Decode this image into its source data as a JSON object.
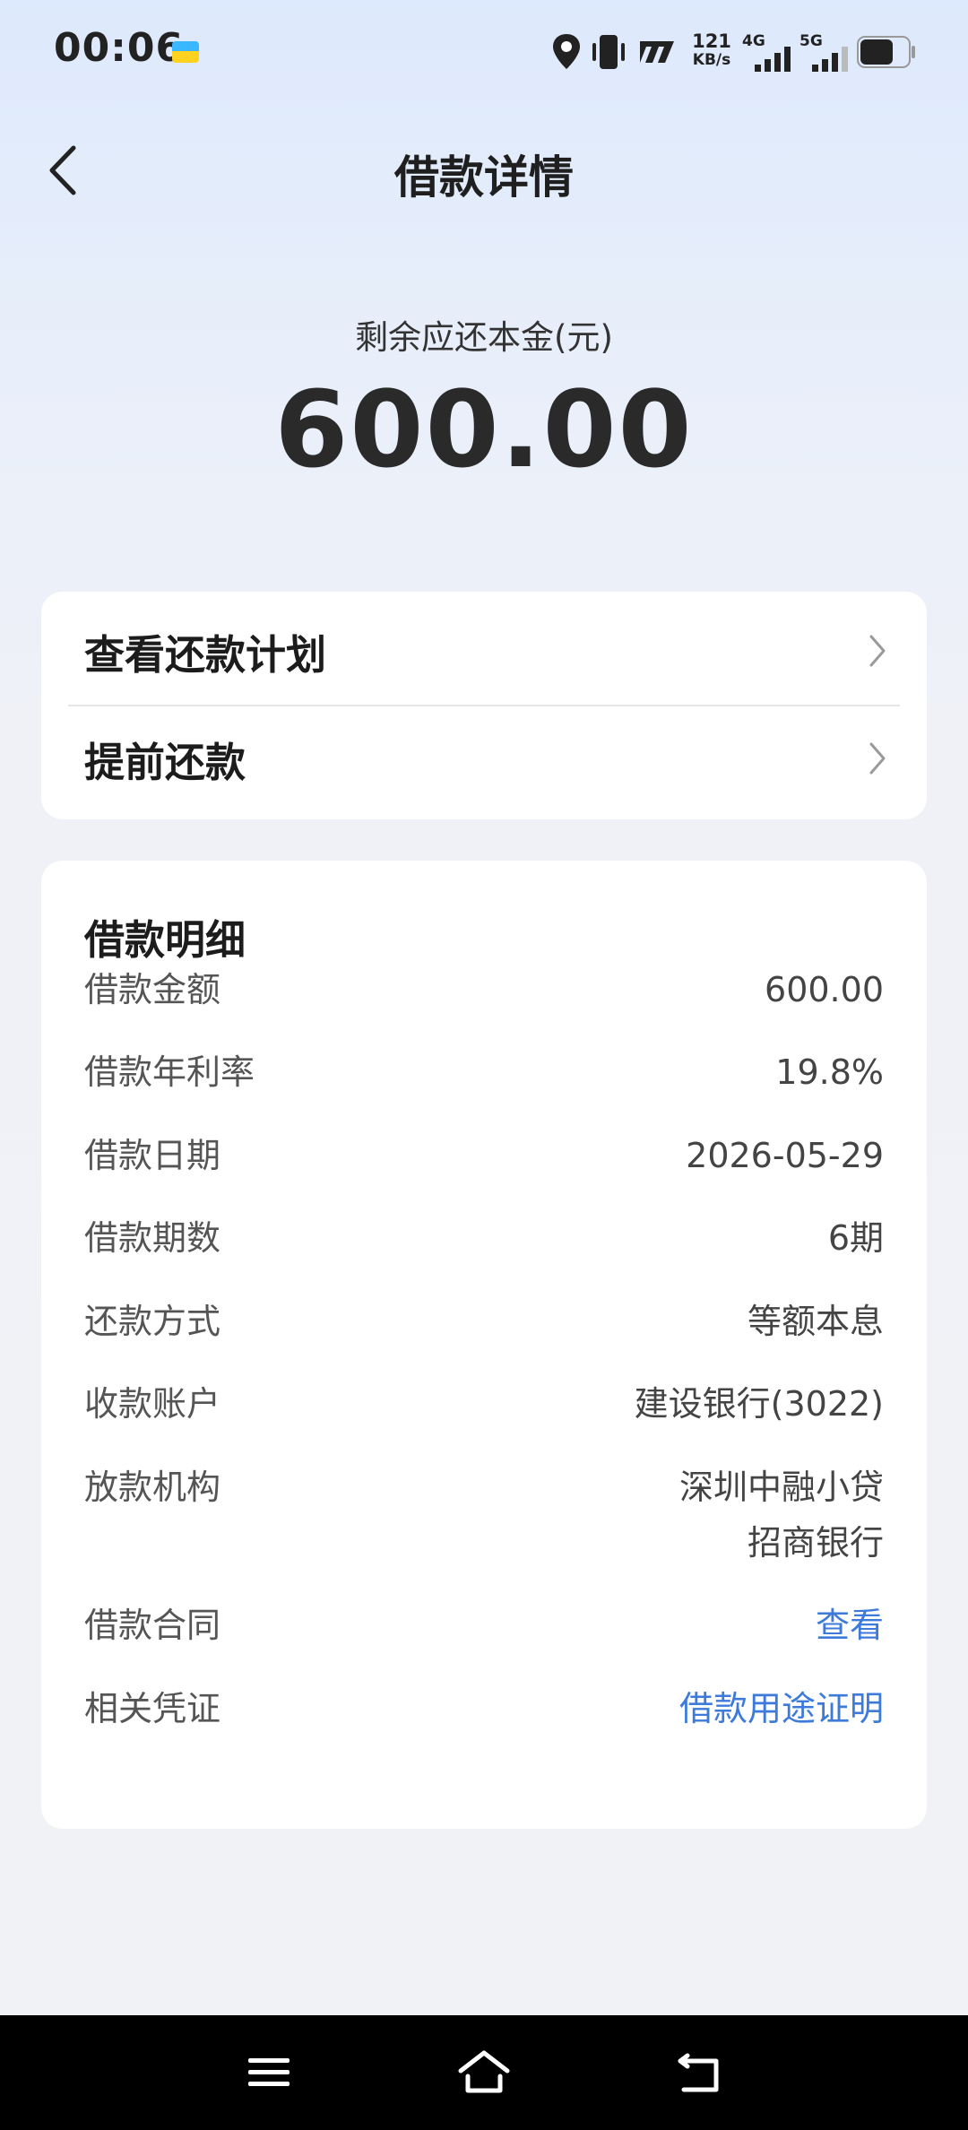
{
  "status_bar": {
    "time": "00:06",
    "network_speed_value": "121",
    "network_speed_unit": "KB/s",
    "signal_1_label": "4G",
    "signal_2_label": "5G",
    "icons": [
      "notification-app-icon",
      "location-icon",
      "vibrate-icon",
      "nfc-icon",
      "signal-icon",
      "signal-icon",
      "battery-icon"
    ]
  },
  "header": {
    "title": "借款详情",
    "back_icon": "chevron-left-icon"
  },
  "summary": {
    "label": "剩余应还本金(元)",
    "amount": "600.00"
  },
  "actions": [
    {
      "label": "查看还款计划",
      "icon": "chevron-right-icon"
    },
    {
      "label": "提前还款",
      "icon": "chevron-right-icon"
    }
  ],
  "details": {
    "title": "借款明细",
    "rows": [
      {
        "label": "借款金额",
        "value": "600.00"
      },
      {
        "label": "借款年利率",
        "value": "19.8%"
      },
      {
        "label": "借款日期",
        "value": "2026-05-29"
      },
      {
        "label": "借款期数",
        "value": "6期"
      },
      {
        "label": "还款方式",
        "value": "等额本息"
      },
      {
        "label": "收款账户",
        "value": "建设银行(3022)"
      },
      {
        "label": "放款机构",
        "value_line1": "深圳中融小贷",
        "value_line2": "招商银行"
      },
      {
        "label": "借款合同",
        "value": "查看"
      },
      {
        "label": "相关凭证",
        "value": "借款用途证明"
      }
    ]
  },
  "colors": {
    "link": "#3d7ad9",
    "background_top": "#dde9fc",
    "background_bottom": "#f1f2f6",
    "card": "#ffffff",
    "nav_bar": "#000000"
  },
  "nav_bar": {
    "icons": [
      "menu-icon",
      "home-icon",
      "back-icon"
    ]
  }
}
